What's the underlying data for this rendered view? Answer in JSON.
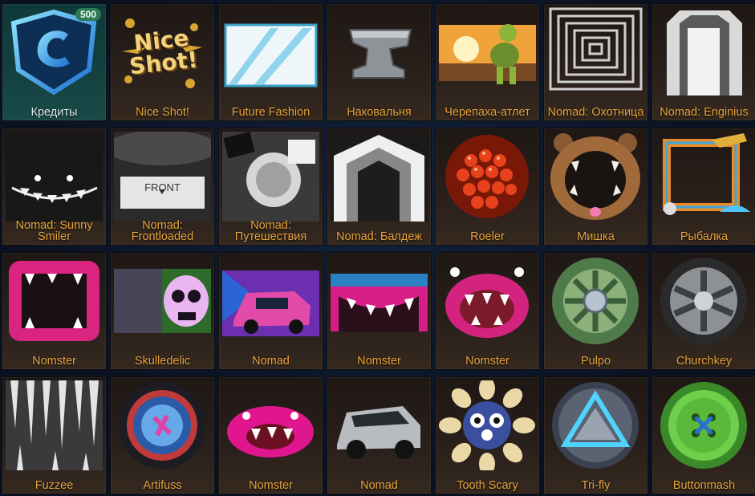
{
  "colors": {
    "label": "#e8a43c",
    "label_selected": "#dfeef0",
    "tile_bg": "#2a201b",
    "tile_selected_bg": "#13403f",
    "badge_bg": "#2e7a52"
  },
  "items": [
    {
      "label": "Кредиты",
      "icon": "credits-icon",
      "badge": "500",
      "selected": true
    },
    {
      "label": "Nice Shot!",
      "icon": "nice-shot-icon"
    },
    {
      "label": "Future Fashion",
      "icon": "future-fashion-icon"
    },
    {
      "label": "Наковальня",
      "icon": "anvil-icon"
    },
    {
      "label": "Черепаха-атлет",
      "icon": "turtle-icon"
    },
    {
      "label": "Nomad: Охотница",
      "icon": "nomad-huntress-icon"
    },
    {
      "label": "Nomad: Enginius",
      "icon": "nomad-enginius-icon"
    },
    {
      "label": "Nomad: Sunny Smiler",
      "icon": "nomad-sunny-smiler-icon"
    },
    {
      "label": "Nomad: Frontloaded",
      "icon": "nomad-frontloaded-icon",
      "text": "FRONT"
    },
    {
      "label": "Nomad: Путешествия",
      "icon": "nomad-travels-icon"
    },
    {
      "label": "Nomad: Балдеж",
      "icon": "nomad-baldezh-icon"
    },
    {
      "label": "Roeler",
      "icon": "roeler-icon"
    },
    {
      "label": "Мишка",
      "icon": "bear-icon"
    },
    {
      "label": "Рыбалка",
      "icon": "fishing-icon"
    },
    {
      "label": "Nomster",
      "icon": "nomster-frame-icon"
    },
    {
      "label": "Skulledelic",
      "icon": "skull-icon"
    },
    {
      "label": "Nomad",
      "icon": "nomad-car-icon"
    },
    {
      "label": "Nomster",
      "icon": "nomster-banner-icon"
    },
    {
      "label": "Nomster",
      "icon": "nomster-mouth-icon"
    },
    {
      "label": "Pulpo",
      "icon": "pulpo-wheel-icon"
    },
    {
      "label": "Churchkey",
      "icon": "churchkey-wheel-icon"
    },
    {
      "label": "Fuzzee",
      "icon": "fuzzee-icon"
    },
    {
      "label": "Artifuss",
      "icon": "artifuss-wheel-icon"
    },
    {
      "label": "Nomster",
      "icon": "nomster-topper-icon"
    },
    {
      "label": "Nomad",
      "icon": "nomad-silver-car-icon"
    },
    {
      "label": "Tooth Scary",
      "icon": "tooth-scary-icon"
    },
    {
      "label": "Tri-fly",
      "icon": "trifly-wheel-icon"
    },
    {
      "label": "Buttonmash",
      "icon": "button-wheel-icon"
    }
  ]
}
